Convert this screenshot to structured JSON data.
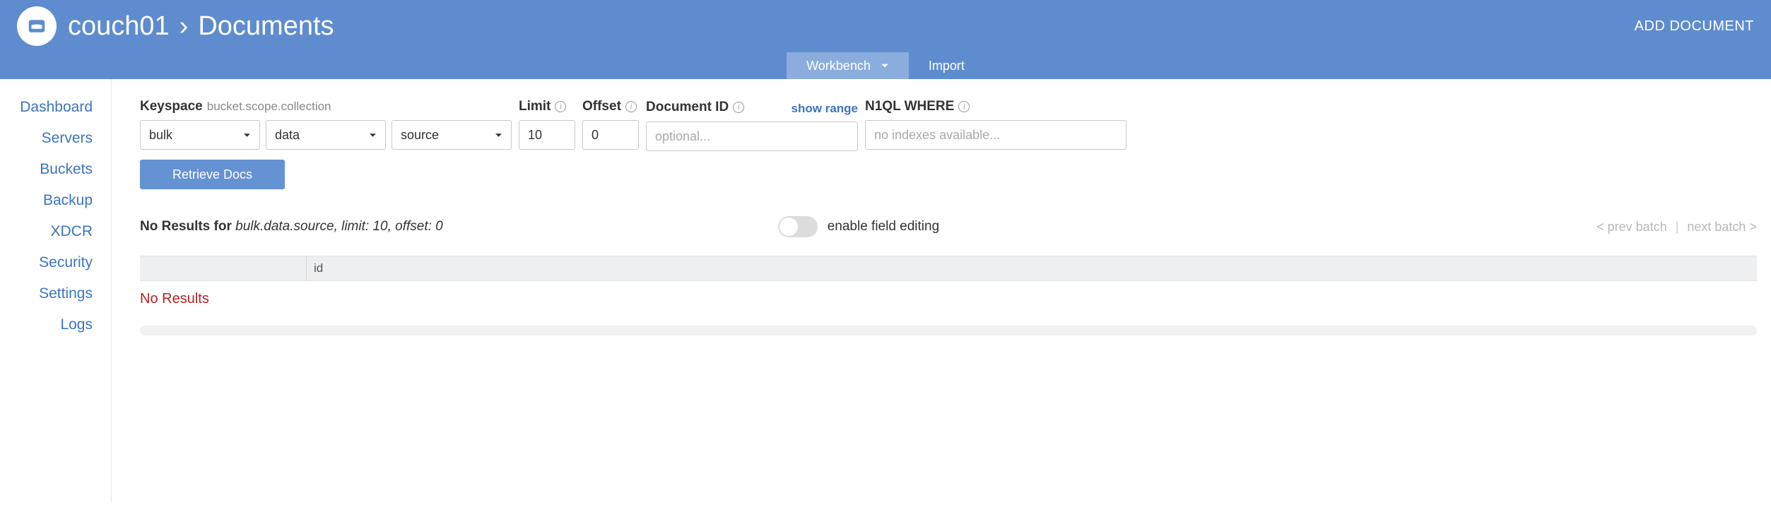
{
  "header": {
    "node": "couch01",
    "page": "Documents",
    "add_doc": "ADD DOCUMENT"
  },
  "tabs": {
    "workbench": "Workbench",
    "import": "Import"
  },
  "sidebar": {
    "items": [
      "Dashboard",
      "Servers",
      "Buckets",
      "Backup",
      "XDCR",
      "Security",
      "Settings",
      "Logs"
    ]
  },
  "filters": {
    "keyspace_label": "Keyspace",
    "keyspace_hint": "bucket.scope.collection",
    "bucket": "bulk",
    "scope": "data",
    "collection": "source",
    "limit_label": "Limit",
    "limit": "10",
    "offset_label": "Offset",
    "offset": "0",
    "docid_label": "Document ID",
    "docid_placeholder": "optional...",
    "docid_value": "",
    "show_range": "show range",
    "n1ql_label": "N1QL WHERE",
    "n1ql_placeholder": "no indexes available...",
    "n1ql_value": "",
    "retrieve": "Retrieve Docs"
  },
  "results": {
    "prefix": "No Results for ",
    "query": "bulk.data.source, limit: 10, offset: 0",
    "toggle_label": "enable field editing",
    "prev": "< prev batch",
    "next": "next batch >",
    "sep": "|",
    "col_id": "id",
    "no_results": "No Results"
  }
}
